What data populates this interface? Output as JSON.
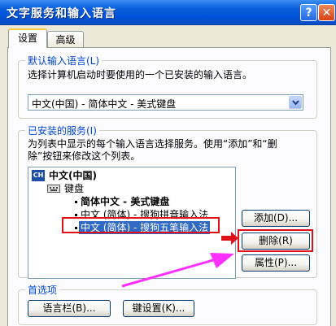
{
  "window": {
    "title": "文字服务和输入语言",
    "help_label": "?",
    "close_label": "✕"
  },
  "tabs": [
    {
      "label": "设置"
    },
    {
      "label": "高级"
    }
  ],
  "default_language": {
    "legend": "默认输入语言(L)",
    "description": "选择计算机启动时要使用的一个已安装的输入语言。",
    "selected": "中文(中国) - 简体中文 - 美式键盘"
  },
  "installed_services": {
    "legend": "已安装的服务(I)",
    "description_line1": "为列表中显示的每个输入语言选择服务。使用“添加”和“删",
    "description_line2": "除”按钮来修改这个列表。",
    "tree": {
      "language_badge": "CH",
      "language": "中文(中国)",
      "category": "键盘",
      "items": [
        "简体中文 - 美式键盘",
        "中文 (简体) - 搜狗拼音输入法",
        "中文 (简体) - 搜狗五笔输入法"
      ]
    },
    "buttons": {
      "add": "添加(D)...",
      "remove": "删除(R)",
      "properties": "属性(P)..."
    }
  },
  "preferences": {
    "legend": "首选项",
    "language_bar_button": "语言栏(B)...",
    "key_settings_button": "键设置(K)..."
  },
  "colors": {
    "title_blue": "#0a5fdc",
    "selection": "#316ac5",
    "highlight_red": "#e0101a",
    "arrow": "#ff30ff"
  }
}
